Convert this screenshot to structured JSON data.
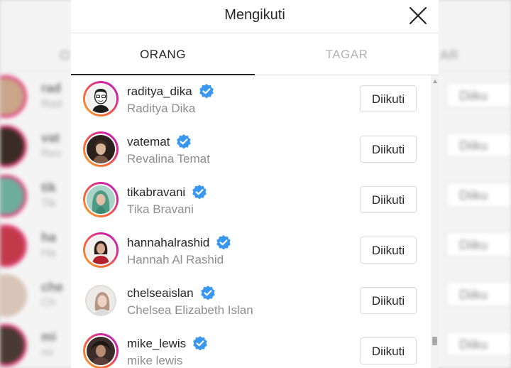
{
  "modal": {
    "title": "Mengikuti",
    "tabs": [
      {
        "label": "ORANG",
        "active": true
      },
      {
        "label": "TAGAR",
        "active": false
      }
    ]
  },
  "accounts": [
    {
      "username": "raditya_dika",
      "full_name": "Raditya Dika",
      "button": "Diikuti",
      "verified": true,
      "story_ring": true
    },
    {
      "username": "vatemat",
      "full_name": "Revalina Temat",
      "button": "Diikuti",
      "verified": true,
      "story_ring": true
    },
    {
      "username": "tikabravani",
      "full_name": "Tika Bravani",
      "button": "Diikuti",
      "verified": true,
      "story_ring": true
    },
    {
      "username": "hannahalrashid",
      "full_name": "Hannah Al Rashid",
      "button": "Diikuti",
      "verified": true,
      "story_ring": true
    },
    {
      "username": "chelseaislan",
      "full_name": "Chelsea Elizabeth Islan",
      "button": "Diikuti",
      "verified": true,
      "story_ring": false
    },
    {
      "username": "mike_lewis",
      "full_name": "mike lewis",
      "button": "Diikuti",
      "verified": true,
      "story_ring": true
    }
  ],
  "colors": {
    "verified_badge": "#3897f0",
    "text_primary": "#262626",
    "text_secondary": "#8e8e8e",
    "border": "#dbdbdb"
  }
}
